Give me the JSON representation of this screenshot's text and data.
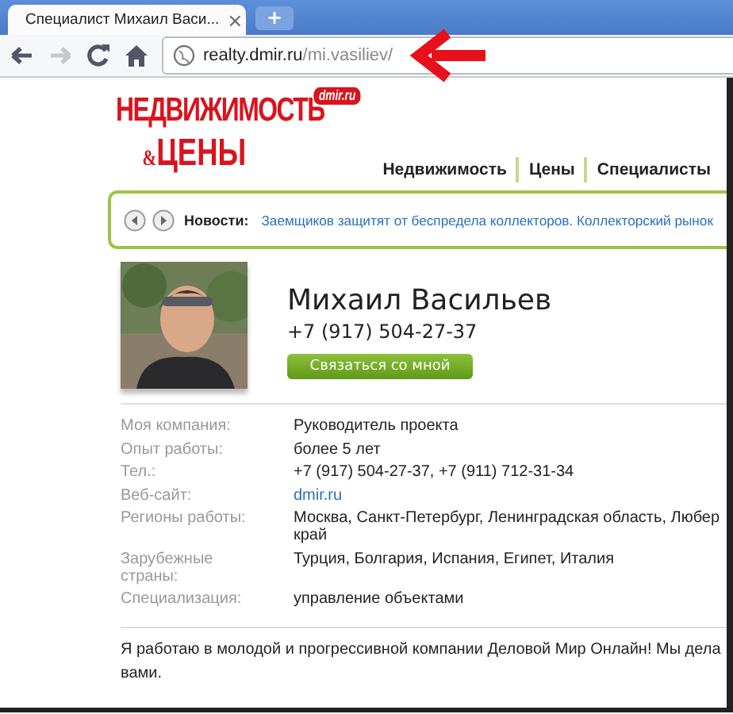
{
  "browser": {
    "tabs": [
      {
        "title": "Специалист Михаил Васи...",
        "close": "×",
        "selected": true
      }
    ],
    "new_tab": "+",
    "address": {
      "host": "realty.dmir.ru",
      "path": "/mi.vasiliev/"
    },
    "forward_disabled": true
  },
  "site": {
    "logo": {
      "line1": "НЕДВИЖИМОСТЬ",
      "line2_prefix": "&",
      "line2": "ЦЕНЫ",
      "badge": "dmir.ru"
    },
    "nav": [
      {
        "label": "Недвижимость"
      },
      {
        "label": "Цены"
      },
      {
        "label": "Специалисты"
      }
    ],
    "news": {
      "label": "Новости:",
      "headline": "Заемщиков защитят от беспредела коллекторов. Коллекторский рынок"
    }
  },
  "profile": {
    "name": "Михаил Васильев",
    "phone": "+7 (917) 504-27-37",
    "contact_button": "Связаться со мной",
    "details": [
      {
        "label": "Моя компания:",
        "value": "Руководитель проекта",
        "kind": "text"
      },
      {
        "label": "Опыт работы:",
        "value": "более 5 лет",
        "kind": "text"
      },
      {
        "label": "Тел.:",
        "value": "+7 (917) 504-27-37, +7 (911) 712-31-34",
        "kind": "text"
      },
      {
        "label": "Веб-сайт:",
        "value": "dmir.ru",
        "kind": "link"
      },
      {
        "label": "Регионы работы:",
        "value": "Москва, Санкт-Петербург, Ленинградская область, Любер",
        "value_2": "край",
        "kind": "text"
      },
      {
        "label": "Зарубежные страны:",
        "value": "Турция, Болгария, Испания, Египет, Италия",
        "kind": "text"
      },
      {
        "label": "Специализация:",
        "value": "управление объектами",
        "kind": "text"
      }
    ],
    "about": [
      "Я работаю в молодой и прогрессивной компании Деловой Мир Онлайн! Мы дела",
      "вами."
    ]
  }
}
